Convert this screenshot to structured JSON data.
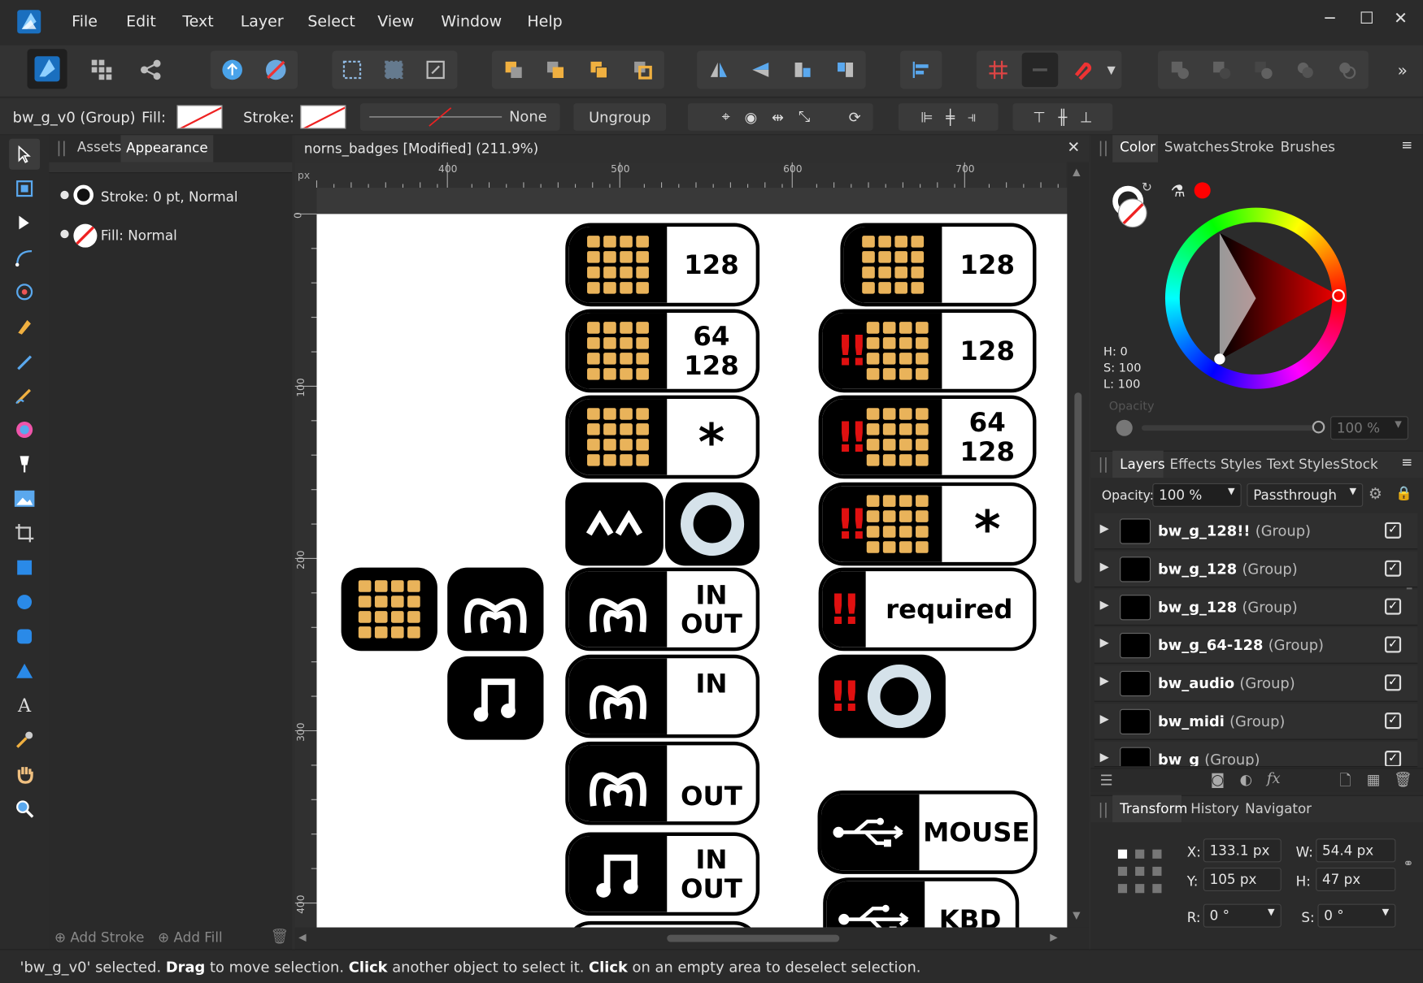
{
  "menubar": {
    "items": [
      "File",
      "Edit",
      "Text",
      "Layer",
      "Select",
      "View",
      "Window",
      "Help"
    ]
  },
  "context": {
    "selection": "bw_g_v0 (Group)",
    "fill_label": "Fill:",
    "stroke_label": "Stroke:",
    "stroke_width": "None",
    "ungroup": "Ungroup"
  },
  "left_panel": {
    "tabs": [
      "Assets",
      "Appearance"
    ],
    "stroke_text": "Stroke: 0 pt,  Normal",
    "fill_text": "Fill:  Normal",
    "add_stroke": "Add Stroke",
    "add_fill": "Add Fill"
  },
  "document": {
    "tab_title": "norns_badges [Modified] (211.9%)",
    "ruler_unit": "px",
    "ruler_h": [
      "400",
      "500",
      "600",
      "700"
    ],
    "ruler_v": [
      "0",
      "100",
      "200",
      "300",
      "400"
    ]
  },
  "badges": {
    "col1": [
      {
        "top": "128"
      },
      {
        "top": "64",
        "bottom": "128"
      },
      {
        "top": "*"
      },
      {
        "top": "IN",
        "bottom": "OUT"
      },
      {
        "top": "IN"
      },
      {
        "bottom": "OUT"
      },
      {
        "top": "IN",
        "bottom": "OUT"
      }
    ],
    "col2": [
      {
        "top": "128"
      },
      {
        "top": "128"
      },
      {
        "top": "64",
        "bottom": "128"
      },
      {
        "top": "*"
      },
      {
        "top": "required"
      },
      {
        "top": "MOUSE"
      },
      {
        "top": "KBD"
      }
    ]
  },
  "color_panel": {
    "tabs": [
      "Color",
      "Swatches",
      "Stroke",
      "Brushes"
    ],
    "h": "H: 0",
    "s": "S: 100",
    "l": "L: 100",
    "opacity_label": "Opacity",
    "opacity_value": "100 %",
    "accent": "#ff0000"
  },
  "layers_panel": {
    "tabs": [
      "Layers",
      "Effects",
      "Styles",
      "Text Styles",
      "Stock"
    ],
    "opacity_label": "Opacity:",
    "opacity_value": "100 %",
    "blend": "Passthrough",
    "layers": [
      {
        "name": "bw_g_128!!",
        "type": "(Group)"
      },
      {
        "name": "bw_g_128",
        "type": "(Group)"
      },
      {
        "name": "bw_g_128",
        "type": "(Group)"
      },
      {
        "name": "bw_g_64-128",
        "type": "(Group)"
      },
      {
        "name": "bw_audio",
        "type": "(Group)"
      },
      {
        "name": "bw_midi",
        "type": "(Group)"
      },
      {
        "name": "bw_g",
        "type": "(Group)"
      }
    ]
  },
  "transform_panel": {
    "tabs": [
      "Transform",
      "History",
      "Navigator"
    ],
    "x_label": "X:",
    "x": "133.1 px",
    "y_label": "Y:",
    "y": "105 px",
    "w_label": "W:",
    "w": "54.4 px",
    "h_label": "H:",
    "h": "47 px",
    "r_label": "R:",
    "r": "0 °",
    "s_label": "S:",
    "s": "0 °"
  },
  "status": {
    "p1": "'bw_g_v0' selected. ",
    "b1": "Drag",
    "p2": " to move selection. ",
    "b2": "Click",
    "p3": " another object to select it. ",
    "b3": "Click",
    "p4": " on an empty area to deselect selection."
  }
}
